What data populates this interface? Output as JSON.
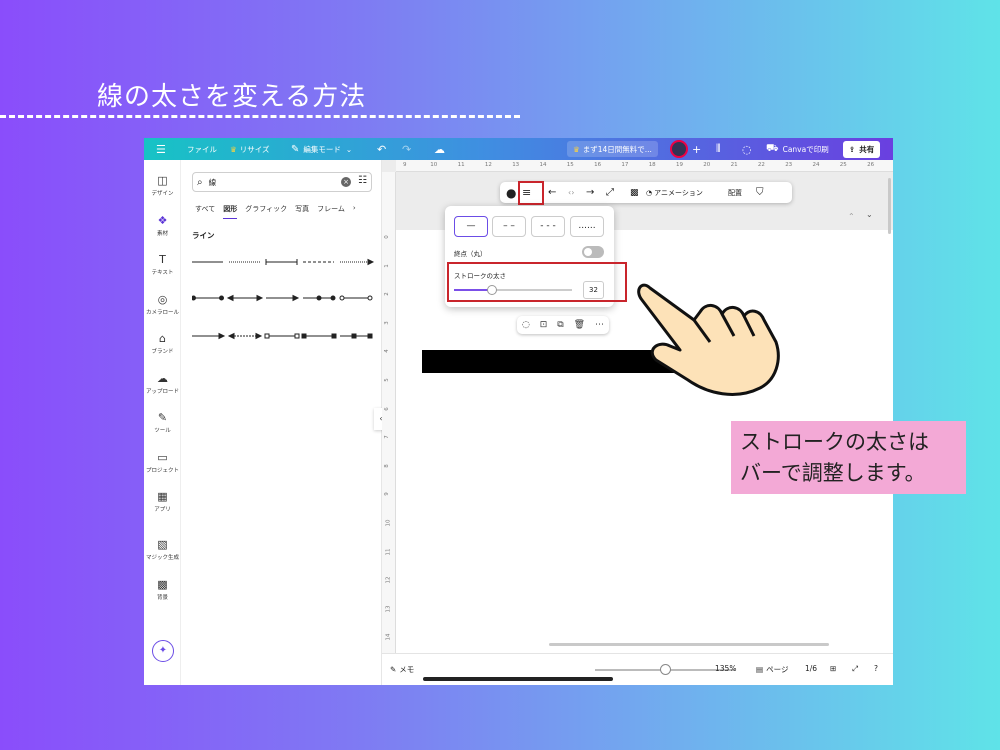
{
  "slide_title": "線の太さを変える方法",
  "callout": {
    "line1": "ストロークの太さは",
    "line2": "バーで調整します。"
  },
  "topbar": {
    "menu_icon": "hamburger-icon",
    "file": "ファイル",
    "resize": "リサイズ",
    "edit_mode": "編集モード",
    "trial": "まず14日間無料で...",
    "print": "Canvaで印刷",
    "share": "共有"
  },
  "rail": [
    {
      "icon": "design-icon",
      "glyph": "◫",
      "label": "デザイン"
    },
    {
      "icon": "elements-icon",
      "glyph": "❖",
      "label": "素材"
    },
    {
      "icon": "text-icon",
      "glyph": "T",
      "label": "テキスト"
    },
    {
      "icon": "camera-icon",
      "glyph": "◎",
      "label": "カメラロール"
    },
    {
      "icon": "brand-icon",
      "glyph": "⌂",
      "label": "ブランド"
    },
    {
      "icon": "upload-icon",
      "glyph": "☁",
      "label": "アップロード"
    },
    {
      "icon": "tools-icon",
      "glyph": "✎",
      "label": "ツール"
    },
    {
      "icon": "folder-icon",
      "glyph": "▭",
      "label": "プロジェクト"
    },
    {
      "icon": "apps-icon",
      "glyph": "▦",
      "label": "アプリ"
    },
    {
      "icon": "magic-icon",
      "glyph": "▧",
      "label": "マジック生成"
    },
    {
      "icon": "background-icon",
      "glyph": "▩",
      "label": "背景"
    }
  ],
  "panel": {
    "search_value": "線",
    "tabs": [
      "すべて",
      "図形",
      "グラフィック",
      "写真",
      "フレーム"
    ],
    "active_tab": "図形",
    "section": "ライン"
  },
  "float_bar": {
    "animation": "アニメーション",
    "position": "配置"
  },
  "popup": {
    "dash_options": [
      "—",
      "– –",
      "- - -",
      "......"
    ],
    "endpoint_label": "終点（丸）",
    "stroke_label": "ストロークの太さ",
    "stroke_value": "32",
    "stroke_fraction": 0.32
  },
  "ruler": {
    "top": [
      "9",
      "10",
      "11",
      "12",
      "13",
      "14",
      "15",
      "16",
      "17",
      "18",
      "19",
      "20",
      "21",
      "22",
      "23",
      "24",
      "25",
      "26"
    ],
    "left": [
      "0",
      "1",
      "2",
      "3",
      "4",
      "5",
      "6",
      "7",
      "8",
      "9",
      "10",
      "11",
      "12",
      "13",
      "14"
    ]
  },
  "bottom": {
    "notes": "メモ",
    "zoom": "135%",
    "pages_label": "ページ",
    "page_count": "1/6"
  }
}
